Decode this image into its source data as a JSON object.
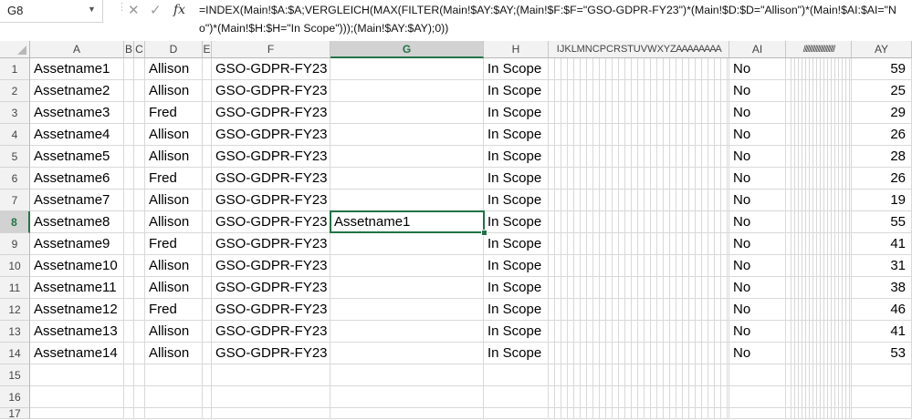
{
  "formula_bar": {
    "name_box": "G8",
    "cancel_icon": "✕",
    "enter_icon": "✓",
    "fx_label": "fx",
    "formula": "=INDEX(Main!$A:$A;VERGLEICH(MAX(FILTER(Main!$AY:$AY;(Main!$F:$F=\"GSO-GDPR-FY23\")*(Main!$D:$D=\"Allison\")*(Main!$AI:$AI=\"No\")*(Main!$H:$H=\"In Scope\")));(Main!$AY:$AY);0))"
  },
  "columns": {
    "A": "A",
    "B": "B",
    "C": "C",
    "D": "D",
    "E": "E",
    "F": "F",
    "G": "G",
    "H": "H",
    "hidden_group": "I J K L M N C P C R S T U V W X Y Z A A A A A A A A",
    "AI": "AI",
    "hidden_group2": "/ / / / / / / / / / / / / / / / / / / / / /",
    "AY": "AY"
  },
  "active_cell": {
    "col": "G",
    "row": "8"
  },
  "rows": [
    {
      "num": "1",
      "A": "Assetname1",
      "D": "Allison",
      "F": "GSO-GDPR-FY23",
      "G": "",
      "H": "In Scope",
      "AI": "No",
      "AY": "59"
    },
    {
      "num": "2",
      "A": "Assetname2",
      "D": "Allison",
      "F": "GSO-GDPR-FY23",
      "G": "",
      "H": "In Scope",
      "AI": "No",
      "AY": "25"
    },
    {
      "num": "3",
      "A": "Assetname3",
      "D": "Fred",
      "F": "GSO-GDPR-FY23",
      "G": "",
      "H": "In Scope",
      "AI": "No",
      "AY": "29"
    },
    {
      "num": "4",
      "A": "Assetname4",
      "D": "Allison",
      "F": "GSO-GDPR-FY23",
      "G": "",
      "H": "In Scope",
      "AI": "No",
      "AY": "26"
    },
    {
      "num": "5",
      "A": "Assetname5",
      "D": "Allison",
      "F": "GSO-GDPR-FY23",
      "G": "",
      "H": "In Scope",
      "AI": "No",
      "AY": "28"
    },
    {
      "num": "6",
      "A": "Assetname6",
      "D": "Fred",
      "F": "GSO-GDPR-FY23",
      "G": "",
      "H": "In Scope",
      "AI": "No",
      "AY": "26"
    },
    {
      "num": "7",
      "A": "Assetname7",
      "D": "Allison",
      "F": "GSO-GDPR-FY23",
      "G": "",
      "H": "In Scope",
      "AI": "No",
      "AY": "19"
    },
    {
      "num": "8",
      "A": "Assetname8",
      "D": "Allison",
      "F": "GSO-GDPR-FY23",
      "G": "Assetname1",
      "H": "In Scope",
      "AI": "No",
      "AY": "55"
    },
    {
      "num": "9",
      "A": "Assetname9",
      "D": "Fred",
      "F": "GSO-GDPR-FY23",
      "G": "",
      "H": "In Scope",
      "AI": "No",
      "AY": "41"
    },
    {
      "num": "10",
      "A": "Assetname10",
      "D": "Allison",
      "F": "GSO-GDPR-FY23",
      "G": "",
      "H": "In Scope",
      "AI": "No",
      "AY": "31"
    },
    {
      "num": "11",
      "A": "Assetname11",
      "D": "Allison",
      "F": "GSO-GDPR-FY23",
      "G": "",
      "H": "In Scope",
      "AI": "No",
      "AY": "38"
    },
    {
      "num": "12",
      "A": "Assetname12",
      "D": "Fred",
      "F": "GSO-GDPR-FY23",
      "G": "",
      "H": "In Scope",
      "AI": "No",
      "AY": "46"
    },
    {
      "num": "13",
      "A": "Assetname13",
      "D": "Allison",
      "F": "GSO-GDPR-FY23",
      "G": "",
      "H": "In Scope",
      "AI": "No",
      "AY": "41"
    },
    {
      "num": "14",
      "A": "Assetname14",
      "D": "Allison",
      "F": "GSO-GDPR-FY23",
      "G": "",
      "H": "In Scope",
      "AI": "No",
      "AY": "53"
    },
    {
      "num": "15",
      "A": "",
      "D": "",
      "F": "",
      "G": "",
      "H": "",
      "AI": "",
      "AY": ""
    },
    {
      "num": "16",
      "A": "",
      "D": "",
      "F": "",
      "G": "",
      "H": "",
      "AI": "",
      "AY": ""
    },
    {
      "num": "17",
      "A": "",
      "D": "",
      "F": "",
      "G": "",
      "H": "",
      "AI": "",
      "AY": ""
    }
  ],
  "colors": {
    "accent": "#217346",
    "header_bg": "#f2f2f2",
    "grid": "#d9d9d9"
  }
}
